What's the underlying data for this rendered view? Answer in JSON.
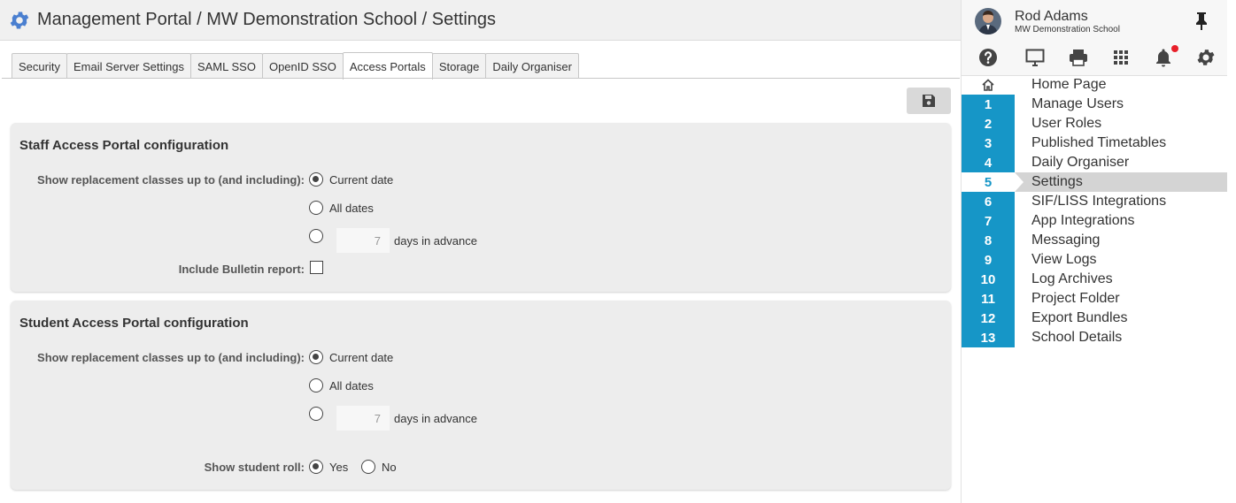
{
  "header": {
    "title": "Management Portal / MW Demonstration School / Settings",
    "icon": "gear-icon",
    "accent": "#4a7fd0"
  },
  "tabs": [
    {
      "label": "Security",
      "active": false
    },
    {
      "label": "Email Server Settings",
      "active": false
    },
    {
      "label": "SAML SSO",
      "active": false
    },
    {
      "label": "OpenID SSO",
      "active": false
    },
    {
      "label": "Access Portals",
      "active": true
    },
    {
      "label": "Storage",
      "active": false
    },
    {
      "label": "Daily Organiser",
      "active": false
    }
  ],
  "toolbar": {
    "save_icon": "floppy-disk-icon"
  },
  "staff_panel": {
    "title": "Staff Access Portal configuration",
    "replacement_label": "Show replacement classes up to (and including):",
    "options": {
      "current_date": "Current date",
      "all_dates": "All dates",
      "days_value": "7",
      "days_suffix": "days in advance"
    },
    "selected": "current_date",
    "bulletin_label": "Include Bulletin report:",
    "bulletin_checked": false
  },
  "student_panel": {
    "title": "Student Access Portal configuration",
    "replacement_label": "Show replacement classes up to (and including):",
    "options": {
      "current_date": "Current date",
      "all_dates": "All dates",
      "days_value": "7",
      "days_suffix": "days in advance"
    },
    "selected": "current_date",
    "roll_label": "Show student roll:",
    "roll_yes": "Yes",
    "roll_no": "No",
    "roll_selected": "yes"
  },
  "user": {
    "name": "Rod Adams",
    "school": "MW Demonstration School"
  },
  "sidebar_icons": [
    "help-icon",
    "monitor-icon",
    "printer-icon",
    "apps-grid-icon",
    "bell-icon",
    "gear-icon"
  ],
  "nav": [
    {
      "num": "",
      "label": "Home Page",
      "icon": "home-icon"
    },
    {
      "num": "1",
      "label": "Manage Users"
    },
    {
      "num": "2",
      "label": "User Roles"
    },
    {
      "num": "3",
      "label": "Published Timetables"
    },
    {
      "num": "4",
      "label": "Daily Organiser"
    },
    {
      "num": "5",
      "label": "Settings",
      "active": true
    },
    {
      "num": "6",
      "label": "SIF/LISS Integrations"
    },
    {
      "num": "7",
      "label": "App Integrations"
    },
    {
      "num": "8",
      "label": "Messaging"
    },
    {
      "num": "9",
      "label": "View Logs"
    },
    {
      "num": "10",
      "label": "Log Archives"
    },
    {
      "num": "11",
      "label": "Project Folder"
    },
    {
      "num": "12",
      "label": "Export Bundles"
    },
    {
      "num": "13",
      "label": "School Details"
    }
  ],
  "colors": {
    "nav_accent": "#1696c7",
    "notification": "#e8202a"
  }
}
